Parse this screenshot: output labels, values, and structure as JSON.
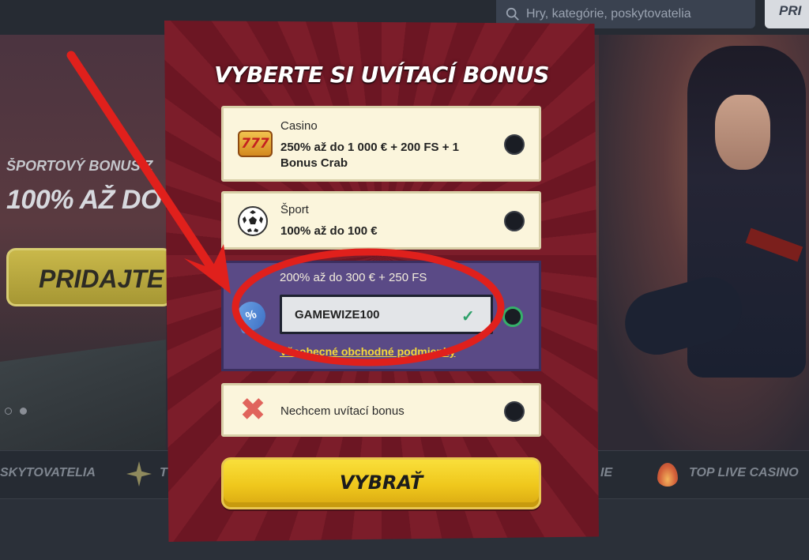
{
  "header": {
    "search_placeholder": "Hry, kategórie, poskytovatelia",
    "right_button_label": "PRI"
  },
  "hero": {
    "kicker": "ŠPORTOVÝ BONUS Z",
    "headline": "100% AŽ DO",
    "button_label": "PRIDAJTE S"
  },
  "category_bar": {
    "items": [
      "SKYTOVATELIA",
      "T",
      "IE",
      "TOP LIVE CASINO"
    ]
  },
  "modal": {
    "title": "VYBERTE SI UVÍTACÍ BONUS",
    "options": [
      {
        "title": "Casino",
        "description": "250% až do 1 000 € + 200 FS + 1 Bonus Crab",
        "icon": "slot-777-icon",
        "selected": false
      },
      {
        "title": "Šport",
        "description": "100% až do 100 €",
        "icon": "soccer-ball-icon",
        "selected": false
      },
      {
        "title": "Nechcem uvítací bonus",
        "description": "",
        "icon": "red-x-icon",
        "selected": false
      }
    ],
    "promo_code": {
      "title": "200% až do 300 € + 250 FS",
      "value": "GAMEWIZE100",
      "link_text": "Všeobecné obchodné podmienky",
      "icon": "percent-tag-icon",
      "valid": true
    },
    "icon_text": {
      "slot": "777",
      "tag": "%"
    },
    "select_button": "VYBRAŤ"
  },
  "colors": {
    "modal_bg": "#7c1d2a",
    "card_bg": "#fbf5dc",
    "code_card_bg": "#5a4a86",
    "button_yellow": "#f2cc22",
    "annotation_red": "#e0201c"
  }
}
